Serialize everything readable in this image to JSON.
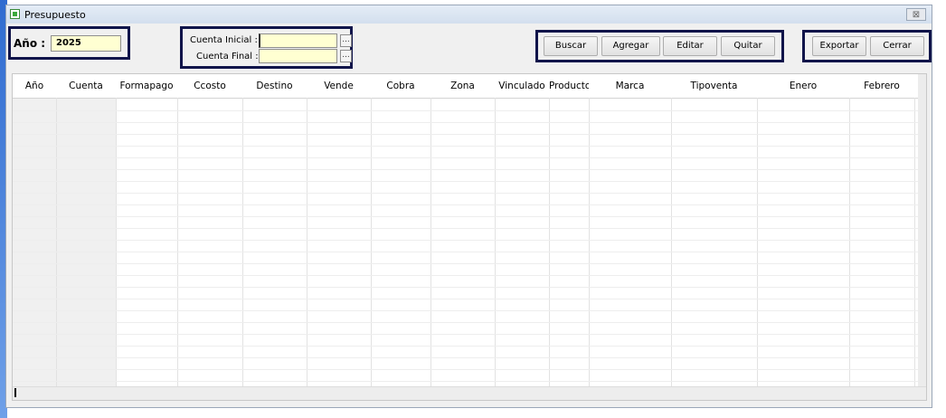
{
  "window": {
    "title": "Presupuesto",
    "close_glyph": "⊠"
  },
  "year": {
    "label": "Año :",
    "value": "2025"
  },
  "account": {
    "initial_label": "Cuenta Inicial :",
    "final_label": "Cuenta Final :",
    "initial_value": "",
    "final_value": "",
    "browse_label": "..."
  },
  "actions": {
    "search": "Buscar",
    "add": "Agregar",
    "edit": "Editar",
    "remove": "Quitar"
  },
  "file_actions": {
    "export": "Exportar",
    "close": "Cerrar"
  },
  "table": {
    "columns": [
      "Año",
      "Cuenta",
      "Formapago",
      "Ccosto",
      "Destino",
      "Vende",
      "Cobra",
      "Zona",
      "Vinculado",
      "Producto",
      "Marca",
      "Tipoventa",
      "Enero",
      "Febrero"
    ],
    "rows": []
  },
  "icons": {
    "app": "spreadsheet-icon",
    "close": "close-icon",
    "browse": "ellipsis-icon"
  }
}
